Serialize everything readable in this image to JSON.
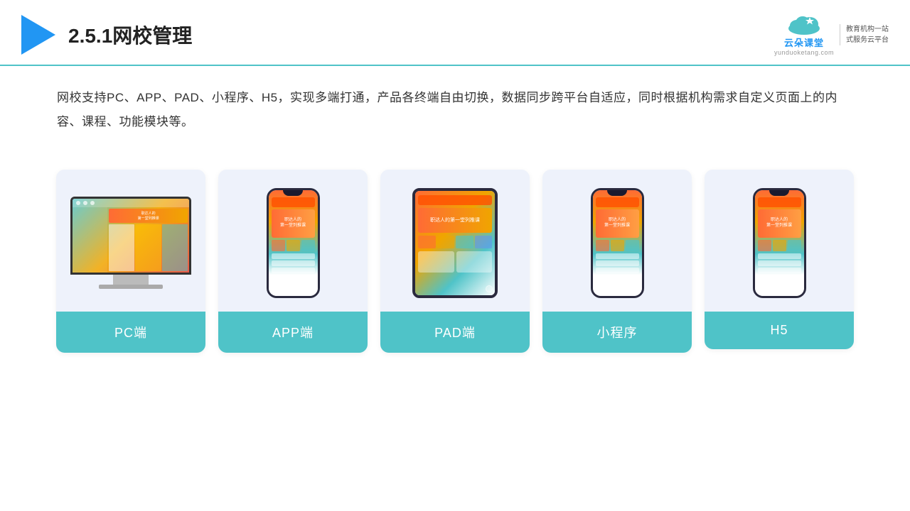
{
  "header": {
    "title": "2.5.1网校管理",
    "logo_main": "云朵课堂",
    "logo_url": "yunduoketang.com",
    "logo_tagline_line1": "教育机构一站",
    "logo_tagline_line2": "式服务云平台"
  },
  "description": {
    "text": "网校支持PC、APP、PAD、小程序、H5，实现多端打通，产品各终端自由切换，数据同步跨平台自适应，同时根据机构需求自定义页面上的内容、课程、功能模块等。"
  },
  "cards": [
    {
      "id": "pc",
      "label": "PC端"
    },
    {
      "id": "app",
      "label": "APP端"
    },
    {
      "id": "pad",
      "label": "PAD端"
    },
    {
      "id": "miniapp",
      "label": "小程序"
    },
    {
      "id": "h5",
      "label": "H5"
    }
  ],
  "colors": {
    "teal": "#4fc3c8",
    "accent_blue": "#2196f3",
    "border_color": "#4fc3c8",
    "card_bg": "#eef2fb"
  }
}
